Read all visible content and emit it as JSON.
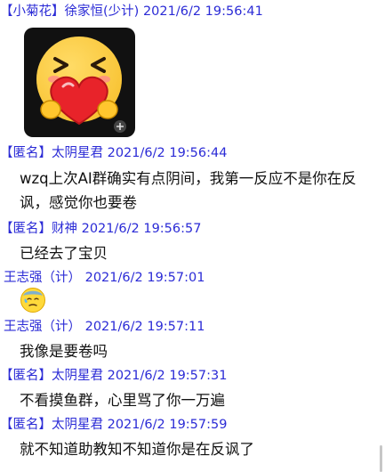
{
  "messages": [
    {
      "tag": "【小菊花】",
      "sender": "徐家恒(少计)",
      "time": "2021/6/2 19:56:41",
      "sticker": "grinning-heart-hug-sticker"
    },
    {
      "tag": "【匿名】",
      "sender": "太阴星君",
      "time": "2021/6/2 19:56:44",
      "text": "wzq上次AI群确实有点阴间，我第一反应不是你在反讽，感觉你也要卷"
    },
    {
      "tag": "【匿名】",
      "sender": "财神",
      "time": "2021/6/2 19:56:57",
      "text": "已经去了宝贝"
    },
    {
      "tag": "",
      "sender": "王志强（计）",
      "time": "2021/6/2 19:57:01",
      "emoji": "cold-sweat-emoji"
    },
    {
      "tag": "",
      "sender": "王志强（计）",
      "time": "2021/6/2 19:57:11",
      "text": "我像是要卷吗"
    },
    {
      "tag": "【匿名】",
      "sender": "太阴星君",
      "time": "2021/6/2 19:57:31",
      "text": "不看摸鱼群，心里骂了你一万遍"
    },
    {
      "tag": "【匿名】",
      "sender": "太阴星君",
      "time": "2021/6/2 19:57:59",
      "text": "就不知道助教知不知道你是在反讽了"
    }
  ],
  "colors": {
    "header": "#2b2bd6",
    "text": "#111111",
    "sticker_bg": "#111111",
    "emoji_face": "#ffd93b"
  }
}
